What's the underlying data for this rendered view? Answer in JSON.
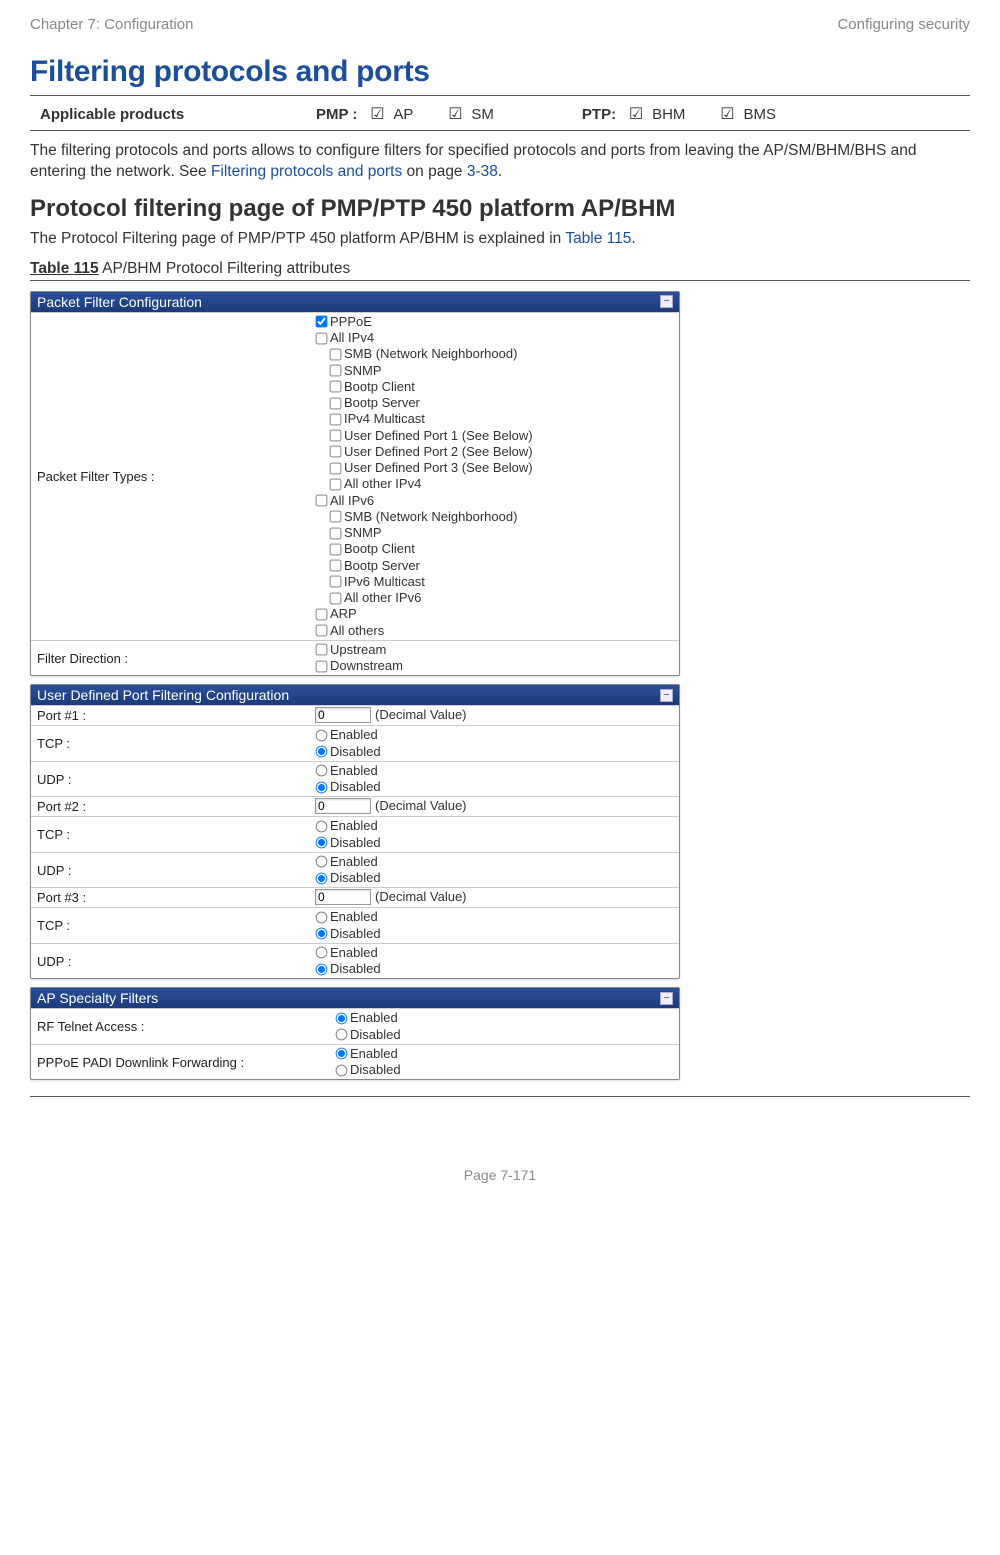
{
  "header": {
    "left": "Chapter 7:  Configuration",
    "right": "Configuring security"
  },
  "title": "Filtering protocols and ports",
  "applicable": {
    "label": "Applicable products",
    "pmp_label": "PMP :",
    "ap": "AP",
    "sm": "SM",
    "ptp_label": "PTP:",
    "bhm": "BHM",
    "bms": "BMS",
    "check": "☑"
  },
  "intro": {
    "t1": "The filtering protocols and ports allows to configure filters for specified protocols and ports from leaving the AP/SM/BHM/BHS and entering the network. See ",
    "link": "Filtering protocols and ports",
    "t2": " on page ",
    "page_ref": "3-38",
    "t3": "."
  },
  "subheading": "Protocol filtering page of PMP/PTP 450 platform AP/BHM",
  "subpara_a": "The Protocol Filtering page of PMP/PTP 450 platform AP/BHM is explained in ",
  "subpara_link": "Table 115",
  "subpara_b": ".",
  "table_caption_a": "Table 115",
  "table_caption_b": " AP/BHM Protocol Filtering attributes",
  "panel1": {
    "title": "Packet Filter Configuration",
    "row_label": "Packet Filter Types :",
    "options": {
      "pppoe": "PPPoE",
      "allipv4": "All IPv4",
      "smb4": "SMB (Network Neighborhood)",
      "snmp4": "SNMP",
      "bootpc4": "Bootp Client",
      "bootps4": "Bootp Server",
      "ipv4mc": "IPv4 Multicast",
      "udp1": "User Defined Port 1 (See Below)",
      "udp2": "User Defined Port 2 (See Below)",
      "udp3": "User Defined Port 3 (See Below)",
      "allother4": "All other IPv4",
      "allipv6": "All IPv6",
      "smb6": "SMB (Network Neighborhood)",
      "snmp6": "SNMP",
      "bootpc6": "Bootp Client",
      "bootps6": "Bootp Server",
      "ipv6mc": "IPv6 Multicast",
      "allother6": "All other IPv6",
      "arp": "ARP",
      "allothers": "All others"
    },
    "dir_label": "Filter Direction :",
    "dir_up": "Upstream",
    "dir_down": "Downstream"
  },
  "panel2": {
    "title": "User Defined Port Filtering Configuration",
    "port1": "Port #1 :",
    "port2": "Port #2 :",
    "port3": "Port #3 :",
    "tcp": "TCP :",
    "udp": "UDP :",
    "decimal": "(Decimal Value)",
    "enabled": "Enabled",
    "disabled": "Disabled",
    "portval": "0"
  },
  "panel3": {
    "title": "AP Specialty Filters",
    "rf": "RF Telnet Access :",
    "pppoe": "PPPoE PADI Downlink Forwarding :",
    "enabled": "Enabled",
    "disabled": "Disabled"
  },
  "footer": "Page 7-171"
}
